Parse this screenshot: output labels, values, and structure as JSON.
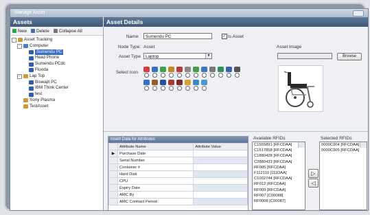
{
  "window": {
    "title": "Manage Asset"
  },
  "left_panel": {
    "title": "Assets",
    "toolbar": {
      "new_label": "New",
      "delete_label": "Delete",
      "collapse_label": "Collapse All"
    },
    "tree": [
      {
        "label": "Asset Tracking",
        "level": 0,
        "expand": "-",
        "icon_color": "#c89a3a"
      },
      {
        "label": "Computer",
        "level": 1,
        "expand": "-",
        "icon_color": "#4a7fc1"
      },
      {
        "label": "Sumendu PC",
        "level": 2,
        "expand": "",
        "icon_color": "#2e5fa8",
        "selected": true
      },
      {
        "label": "Head Phone",
        "level": 2,
        "expand": "",
        "icon_color": "#2e5fa8"
      },
      {
        "label": "Sumendu PCdc",
        "level": 2,
        "expand": "",
        "icon_color": "#2e5fa8"
      },
      {
        "label": "Florida",
        "level": 2,
        "expand": "",
        "icon_color": "#2e5fa8"
      },
      {
        "label": "Lap Top",
        "level": 1,
        "expand": "-",
        "icon_color": "#c89a3a"
      },
      {
        "label": "Biswajit PC",
        "level": 2,
        "expand": "",
        "icon_color": "#2e5fa8"
      },
      {
        "label": "IBM Think Center",
        "level": 2,
        "expand": "",
        "icon_color": "#2e5fa8"
      },
      {
        "label": "test",
        "level": 2,
        "expand": "",
        "icon_color": "#2e5fa8"
      },
      {
        "label": "Sony Plasma",
        "level": 1,
        "expand": "",
        "icon_color": "#c89a3a"
      },
      {
        "label": "TestAsset",
        "level": 1,
        "expand": "",
        "icon_color": "#c89a3a"
      }
    ]
  },
  "details": {
    "title": "Asset Details",
    "name_label": "Name:",
    "name_value": "Sumendu PC",
    "is_asset_label": "Is Asset",
    "is_asset_checked": "✓",
    "node_type_label": "Node Type:",
    "node_type_value": "Asset",
    "asset_type_label": "Asset Type",
    "asset_type_value": "Laptop",
    "select_icon_label": "Select Icon",
    "asset_image_label": "Asset Image",
    "browse_label": "Browse",
    "icon_colors_row1": [
      "#d04040",
      "#3a6fc4",
      "#3aa24a",
      "#c08a2a",
      "#b83a3a",
      "#8a8a8a",
      "#4d9a4d",
      "#3a76c4",
      "#7a7a7a",
      "#2f8f5f",
      "#3a5fb0",
      "#555555"
    ],
    "icon_colors_row2": [
      "#3a6fc4",
      "#9a5a2a",
      "#2a4f9a",
      "#a83a3a",
      "#7a2a2a",
      "#d8a030",
      "#3a8ac4",
      "#4a9ad4"
    ]
  },
  "attributes": {
    "caption": "Insert Data for Attributes",
    "col_name": "Attribute Name",
    "col_value": "Attribute Value",
    "rows": [
      "Purchase Date",
      "Serial Number",
      "Container #",
      "Hard Disk",
      "CPU",
      "Expiry Date",
      "AMC By",
      "AMC Contract Period"
    ]
  },
  "rfid": {
    "available_label": "Available RFIDs",
    "selected_label": "Selected RFIDs",
    "available": [
      "C1555891 [RFCDAA]",
      "C1517858 [RFCDAA]",
      "C1880428 [RFCDAA]",
      "C2880433 [RFCDAA]",
      "RF005 [RFCDAA]",
      "F112110 [111DAA]",
      "C1002744 [RFCDAA]",
      "RF012 [RFCDAA]",
      "RF009 [RFCDAA]",
      "RF007 [C00088]",
      "RF0008 [C00087]"
    ],
    "selected": [
      "0000C004 [RFCDAA]",
      "0000C005 [RFCDAA]"
    ],
    "add_button": "▷",
    "remove_button": "◁"
  }
}
